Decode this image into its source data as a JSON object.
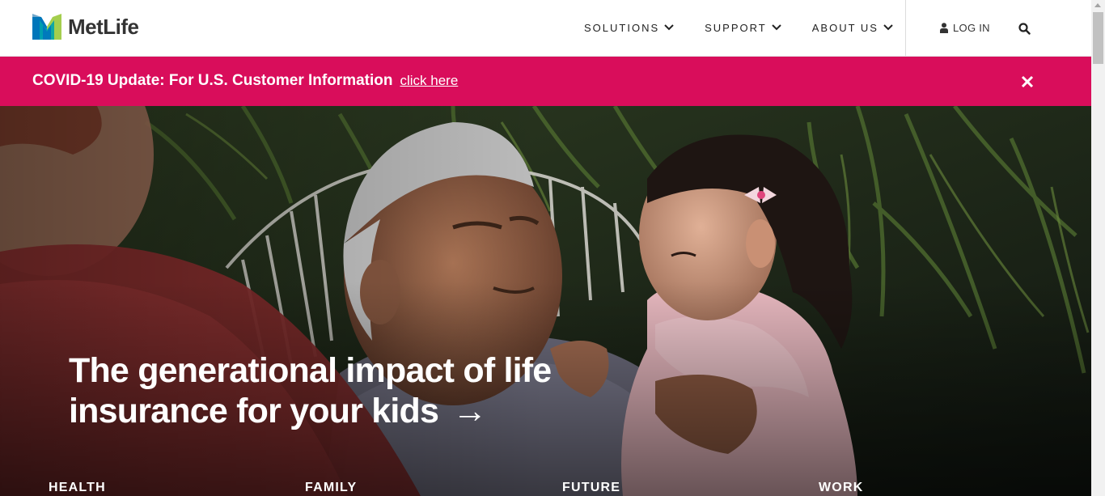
{
  "header": {
    "logo_text": "MetLife",
    "nav": [
      {
        "label": "SOLUTIONS"
      },
      {
        "label": "SUPPORT"
      },
      {
        "label": "ABOUT US"
      }
    ],
    "login_label": "LOG IN"
  },
  "banner": {
    "text": "COVID-19 Update: For U.S. Customer Information",
    "link_label": "click here"
  },
  "hero": {
    "headline_line1": "The generational impact of life",
    "headline_line2": "insurance for your kids",
    "arrow": "→"
  },
  "categories": [
    {
      "label": "HEALTH"
    },
    {
      "label": "FAMILY"
    },
    {
      "label": "FUTURE"
    },
    {
      "label": "WORK"
    }
  ],
  "colors": {
    "banner": "#d90d5b",
    "logo_green": "#a4ce4e",
    "logo_blue": "#0090da",
    "logo_teal": "#007abc"
  },
  "icons": [
    "chevron-down-icon",
    "user-icon",
    "search-icon",
    "close-icon",
    "arrow-right-icon"
  ]
}
